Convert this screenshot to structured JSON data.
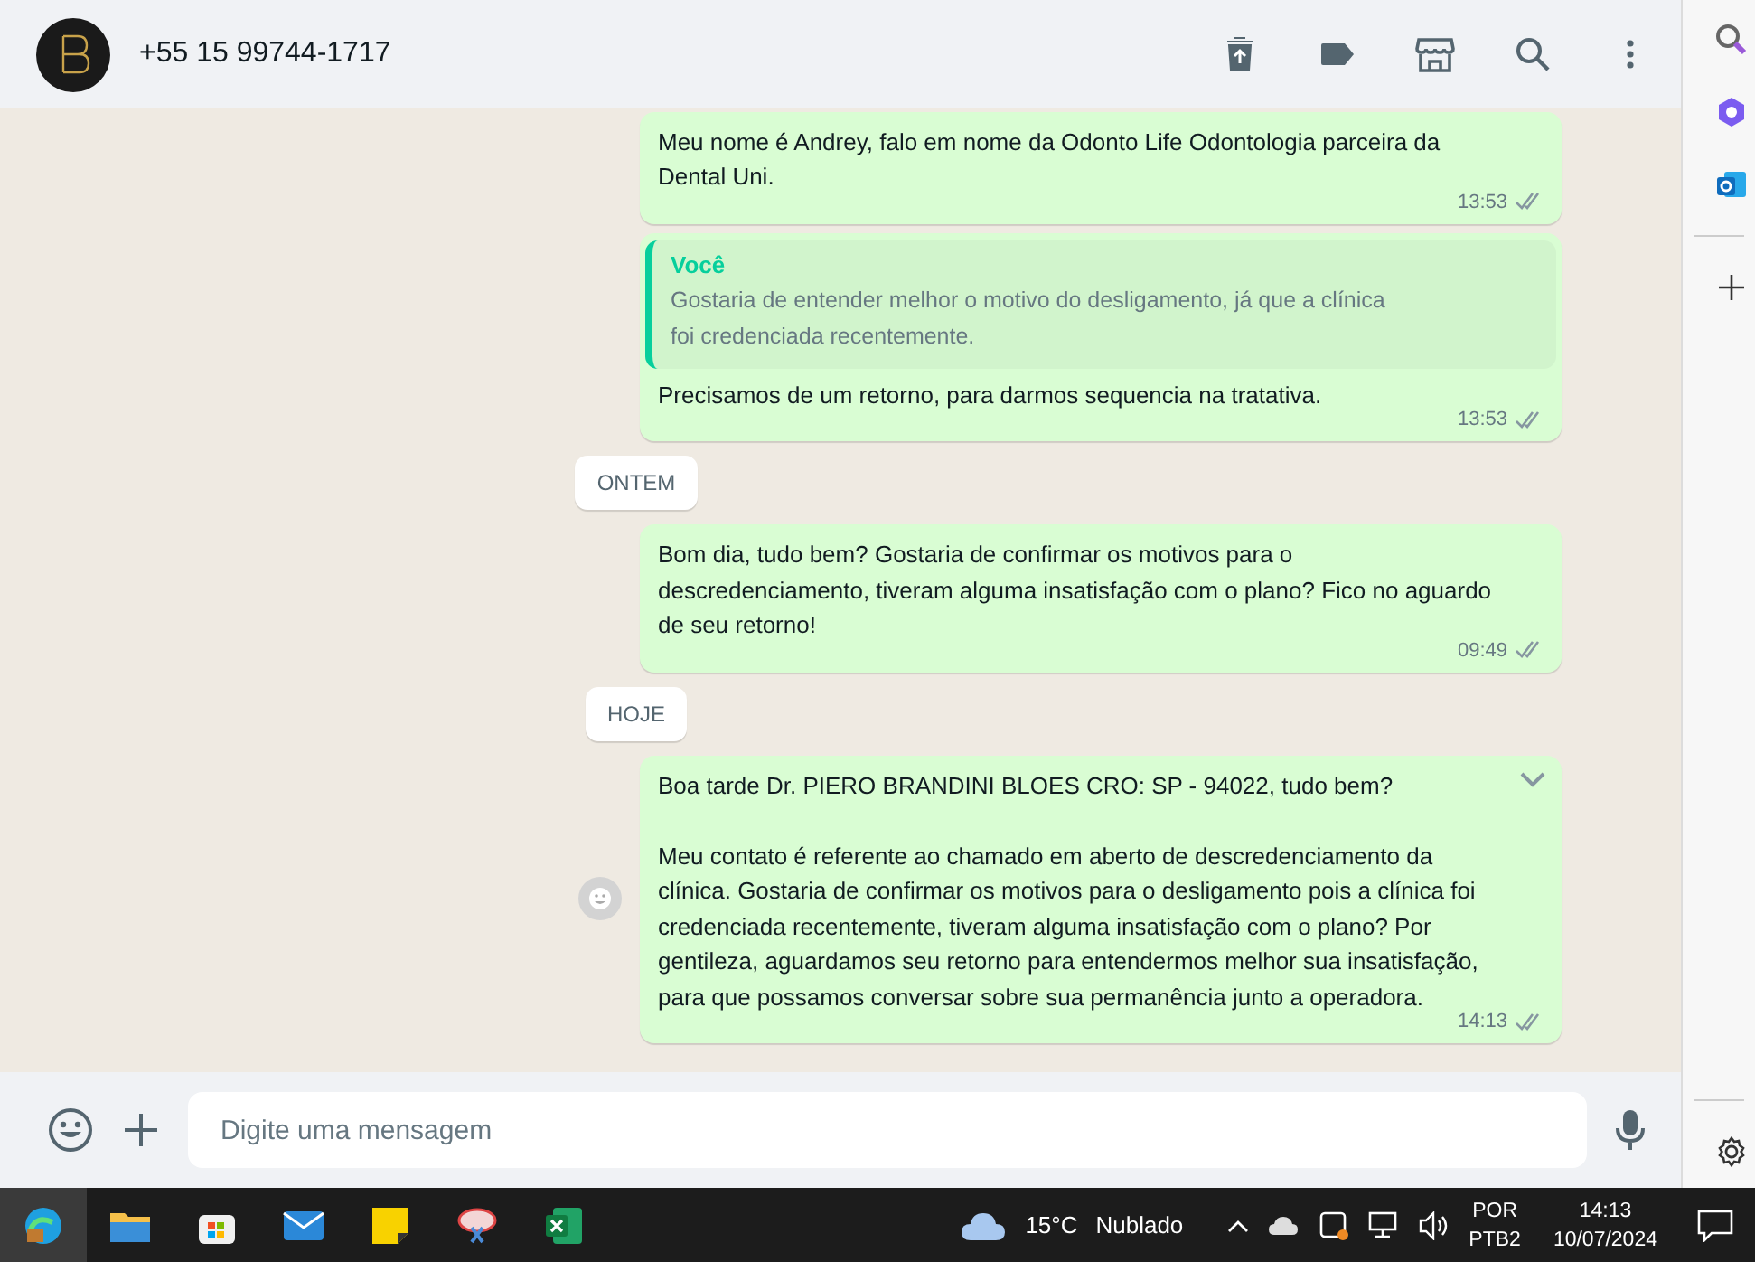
{
  "header": {
    "contact": "+55 15 99744-1717"
  },
  "messages": [
    {
      "kind": "text",
      "lines": [
        "Meu nome é Andrey, falo em nome da Odonto Life Odontologia parceira da Dental Uni."
      ],
      "time": "13:53",
      "menu": false,
      "react": false
    },
    {
      "kind": "reply",
      "quote_author": "Você",
      "quote": "Gostaria de entender melhor o motivo do desligamento, já que a clínica foi credenciada recentemente.",
      "lines": [
        "Precisamos de um retorno, para darmos sequencia na tratativa."
      ],
      "time": "13:53",
      "menu": false,
      "react": false
    },
    {
      "kind": "date",
      "label": "ONTEM"
    },
    {
      "kind": "text",
      "lines": [
        "Bom dia, tudo bem? Gostaria de confirmar os motivos para o descredenciamento, tiveram alguma insatisfação com o plano? Fico no aguardo de seu retorno!"
      ],
      "time": "09:49",
      "menu": false,
      "react": false
    },
    {
      "kind": "date",
      "label": "HOJE"
    },
    {
      "kind": "text",
      "lines": [
        "Boa tarde Dr. PIERO BRANDINI BLOES CRO: SP - 94022, tudo bem?",
        "Meu contato é referente ao chamado em aberto de descredenciamento da clínica. Gostaria de confirmar os motivos para o desligamento pois a clínica foi credenciada recentemente, tiveram alguma insatisfação com o plano? Por gentileza, aguardamos seu retorno para entendermos melhor sua insatisfação, para que possamos conversar sobre sua permanência junto a operadora."
      ],
      "time": "14:13",
      "menu": true,
      "react": true
    }
  ],
  "composer": {
    "placeholder": "Digite uma mensagem"
  },
  "taskbar": {
    "temperature": "15°C",
    "weather": "Nublado",
    "language": "POR",
    "layout": "PTB2",
    "time": "14:13",
    "date": "10/07/2024"
  }
}
